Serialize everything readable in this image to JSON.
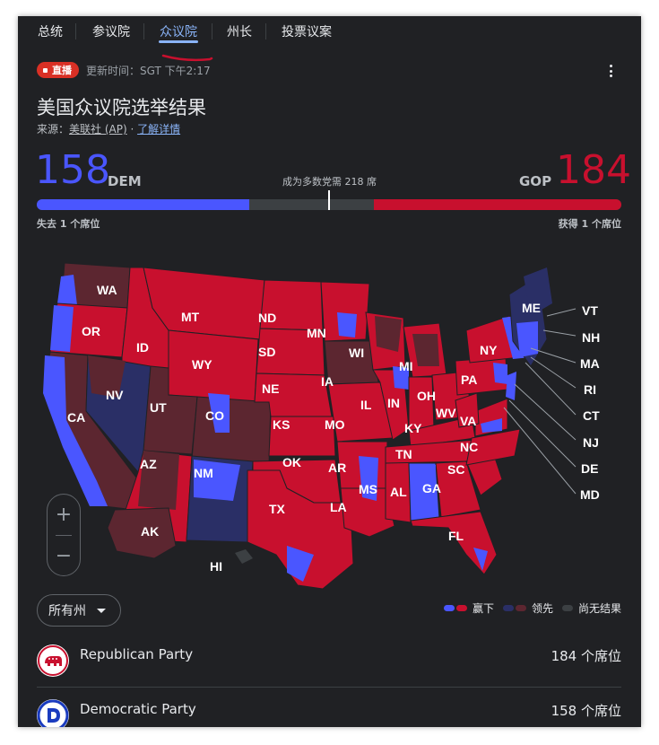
{
  "nav": {
    "tabs": [
      {
        "label": "总统"
      },
      {
        "label": "参议院"
      },
      {
        "label": "众议院",
        "active": true
      },
      {
        "label": "州长"
      },
      {
        "label": "投票议案"
      }
    ]
  },
  "header": {
    "live_label": "直播",
    "update_time": "更新时间：SGT 下午2:17",
    "title": "美国众议院选举结果",
    "source_prefix": "来源：",
    "source_name": "美联社 (AP)",
    "source_sep": " · ",
    "learn_more": "了解详情"
  },
  "tally": {
    "dem_seats": "158",
    "dem_label": "DEM",
    "gop_seats": "184",
    "gop_label": "GOP",
    "majority_text": "成为多数党需 218 席",
    "total_seats": 435,
    "majority": 218,
    "dem_change": "失去 1 个席位",
    "gop_change": "获得 1 个席位"
  },
  "colors": {
    "dem": "#4a56ff",
    "gop": "#c8102e",
    "dem_lead": "#2a2f66",
    "gop_lead": "#5c2630",
    "no_result": "#3c4043",
    "accent": "#8ab4f8"
  },
  "map": {
    "state_labels": [
      "WA",
      "OR",
      "CA",
      "ID",
      "NV",
      "MT",
      "WY",
      "UT",
      "AZ",
      "CO",
      "NM",
      "ND",
      "SD",
      "NE",
      "KS",
      "OK",
      "TX",
      "MN",
      "IA",
      "MO",
      "AR",
      "LA",
      "WI",
      "IL",
      "MS",
      "MI",
      "IN",
      "KY",
      "TN",
      "AL",
      "OH",
      "WV",
      "VA",
      "NC",
      "SC",
      "GA",
      "FL",
      "PA",
      "NY",
      "ME",
      "AK",
      "HI"
    ],
    "callouts": [
      "VT",
      "NH",
      "MA",
      "RI",
      "CT",
      "NJ",
      "DE",
      "MD"
    ]
  },
  "controls": {
    "zoom_in": "+",
    "zoom_out": "−",
    "filter_label": "所有州"
  },
  "legend": {
    "won": "赢下",
    "leading": "领先",
    "no_results": "尚无结果"
  },
  "parties": [
    {
      "name": "Republican Party",
      "seats": "184 个席位"
    },
    {
      "name": "Democratic Party",
      "seats": "158 个席位"
    }
  ]
}
